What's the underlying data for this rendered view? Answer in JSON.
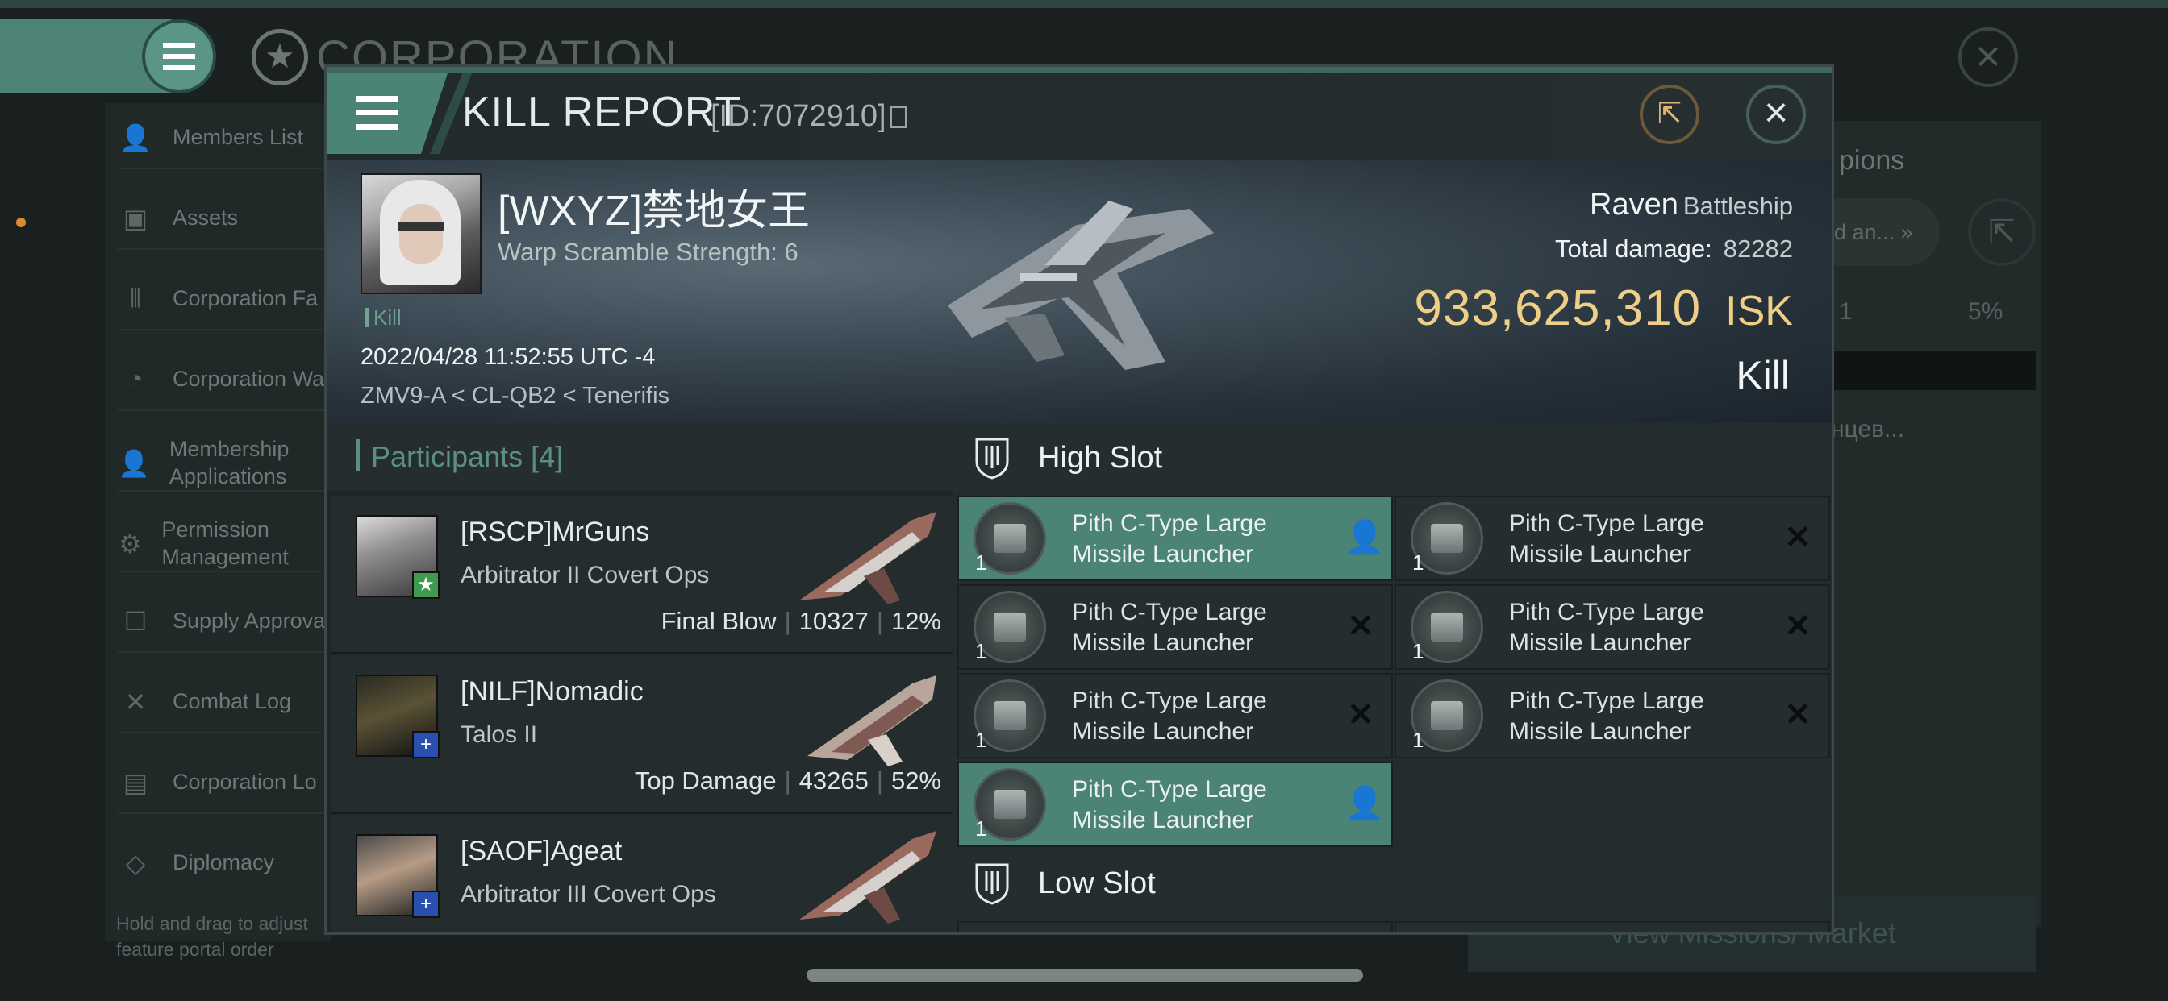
{
  "background": {
    "title": "CORPORATION",
    "sidebar_items": [
      {
        "label": "Members List",
        "icon": "members-icon"
      },
      {
        "label": "Assets",
        "icon": "assets-icon"
      },
      {
        "label": "Corporation Fa",
        "icon": "facilities-icon"
      },
      {
        "label": "Corporation Wa",
        "icon": "wallet-icon"
      },
      {
        "label": "Membership Applications",
        "icon": "applications-icon"
      },
      {
        "label": "Permission Management",
        "icon": "permission-icon"
      },
      {
        "label": "Supply Approva",
        "icon": "supply-icon"
      },
      {
        "label": "Combat Log",
        "icon": "combat-icon"
      },
      {
        "label": "Corporation Lo",
        "icon": "log-icon"
      },
      {
        "label": "Diplomacy",
        "icon": "diplomacy-icon"
      }
    ],
    "hint": "Hold and drag to adjust feature portal order",
    "missions_label": "pions",
    "pill_text": "d an... »",
    "num_value": "1",
    "pct_value": "5%",
    "cyrillic_text": "нцев...",
    "market_button": "View Missions/ Market"
  },
  "dialog": {
    "title": "KILL REPORT",
    "id_label": "[ID:7072910]",
    "victim": {
      "name": "[WXYZ]禁地女王",
      "warp": "Warp Scramble Strength: 6",
      "tag": "Kill",
      "date": "2022/04/28 11:52:55 UTC -4",
      "location": "ZMV9-A < CL-QB2 < Tenerifis",
      "ship": "Raven",
      "ship_class": "Battleship",
      "total_damage_label": "Total damage:",
      "total_damage": "82282",
      "isk_value": "933,625,310",
      "isk_unit": "ISK",
      "result": "Kill"
    },
    "participants": {
      "title": "Participants [4]",
      "rows": [
        {
          "name": "[RSCP]MrGuns",
          "ship": "Arbitrator II Covert Ops",
          "role": "Final Blow",
          "damage": "10327",
          "percent": "12%",
          "badge": "★",
          "badge_color": "#3f9a4f"
        },
        {
          "name": "[NILF]Nomadic",
          "ship": "Talos II",
          "role": "Top Damage",
          "damage": "43265",
          "percent": "52%",
          "badge": "+",
          "badge_color": "#2a4fb0"
        },
        {
          "name": "[SAOF]Ageat",
          "ship": "Arbitrator III Covert Ops",
          "role": "",
          "damage": "",
          "percent": "",
          "badge": "+",
          "badge_color": "#2a4fb0"
        }
      ]
    },
    "high_slot": {
      "label": "High Slot",
      "modules": [
        {
          "name": "Pith C-Type Large Missile Launcher",
          "qty": "1",
          "state": "dropped"
        },
        {
          "name": "Pith C-Type Large Missile Launcher",
          "qty": "1",
          "state": "destroyed"
        },
        {
          "name": "Pith C-Type Large Missile Launcher",
          "qty": "1",
          "state": "destroyed"
        },
        {
          "name": "Pith C-Type Large Missile Launcher",
          "qty": "1",
          "state": "destroyed"
        },
        {
          "name": "Pith C-Type Large Missile Launcher",
          "qty": "1",
          "state": "destroyed"
        },
        {
          "name": "Pith C-Type Large Missile Launcher",
          "qty": "1",
          "state": "destroyed"
        },
        {
          "name": "Pith C-Type Large Missile Launcher",
          "qty": "1",
          "state": "dropped"
        }
      ]
    },
    "low_slot": {
      "label": "Low Slot"
    }
  }
}
